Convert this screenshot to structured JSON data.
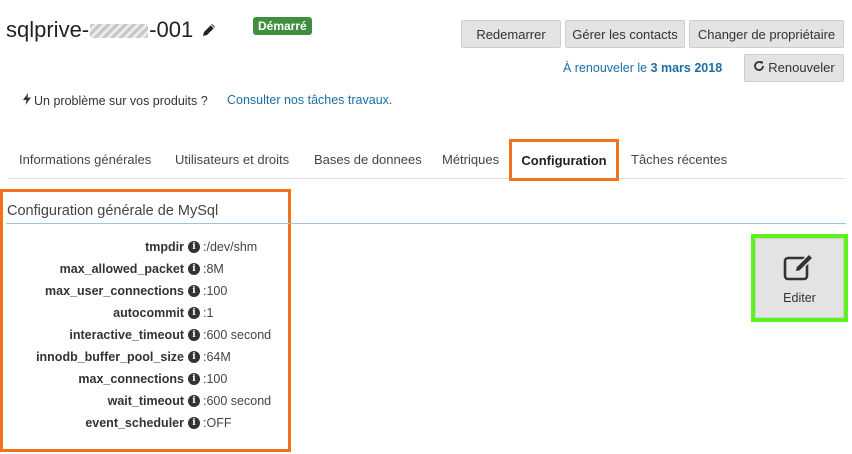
{
  "header": {
    "title_prefix": "sqlprive-",
    "title_suffix": "-001",
    "status": "Démarré",
    "buttons": {
      "restart": "Redemarrer",
      "contacts": "Gérer les contacts",
      "owner": "Changer de propriétaire",
      "renew": "Renouveler"
    },
    "renew_prefix": "À renouveler le",
    "renew_date": "3 mars 2018"
  },
  "problem": {
    "text": "Un problème sur vos produits ?",
    "link": "Consulter nos tâches travaux."
  },
  "tabs": [
    {
      "label": "Informations générales"
    },
    {
      "label": "Utilisateurs et droits"
    },
    {
      "label": "Bases de donnees"
    },
    {
      "label": "Métriques"
    },
    {
      "label": "Configuration"
    },
    {
      "label": "Tâches récentes"
    }
  ],
  "section": {
    "title": "Configuration générale de MySql",
    "params": [
      {
        "name": "tmpdir",
        "value": ":/dev/shm"
      },
      {
        "name": "max_allowed_packet",
        "value": ":8M"
      },
      {
        "name": "max_user_connections",
        "value": ":100"
      },
      {
        "name": "autocommit",
        "value": ":1"
      },
      {
        "name": "interactive_timeout",
        "value": ":600 second"
      },
      {
        "name": "innodb_buffer_pool_size",
        "value": ":64M"
      },
      {
        "name": "max_connections",
        "value": ":100"
      },
      {
        "name": "wait_timeout",
        "value": ":600 second"
      },
      {
        "name": "event_scheduler",
        "value": ":OFF"
      }
    ]
  },
  "edit_button": {
    "label": "Editer"
  },
  "colors": {
    "highlight_orange": "#f07219",
    "highlight_green": "#5cf21c",
    "status_green": "#3f8f3f",
    "link_blue": "#1a6fa8"
  }
}
